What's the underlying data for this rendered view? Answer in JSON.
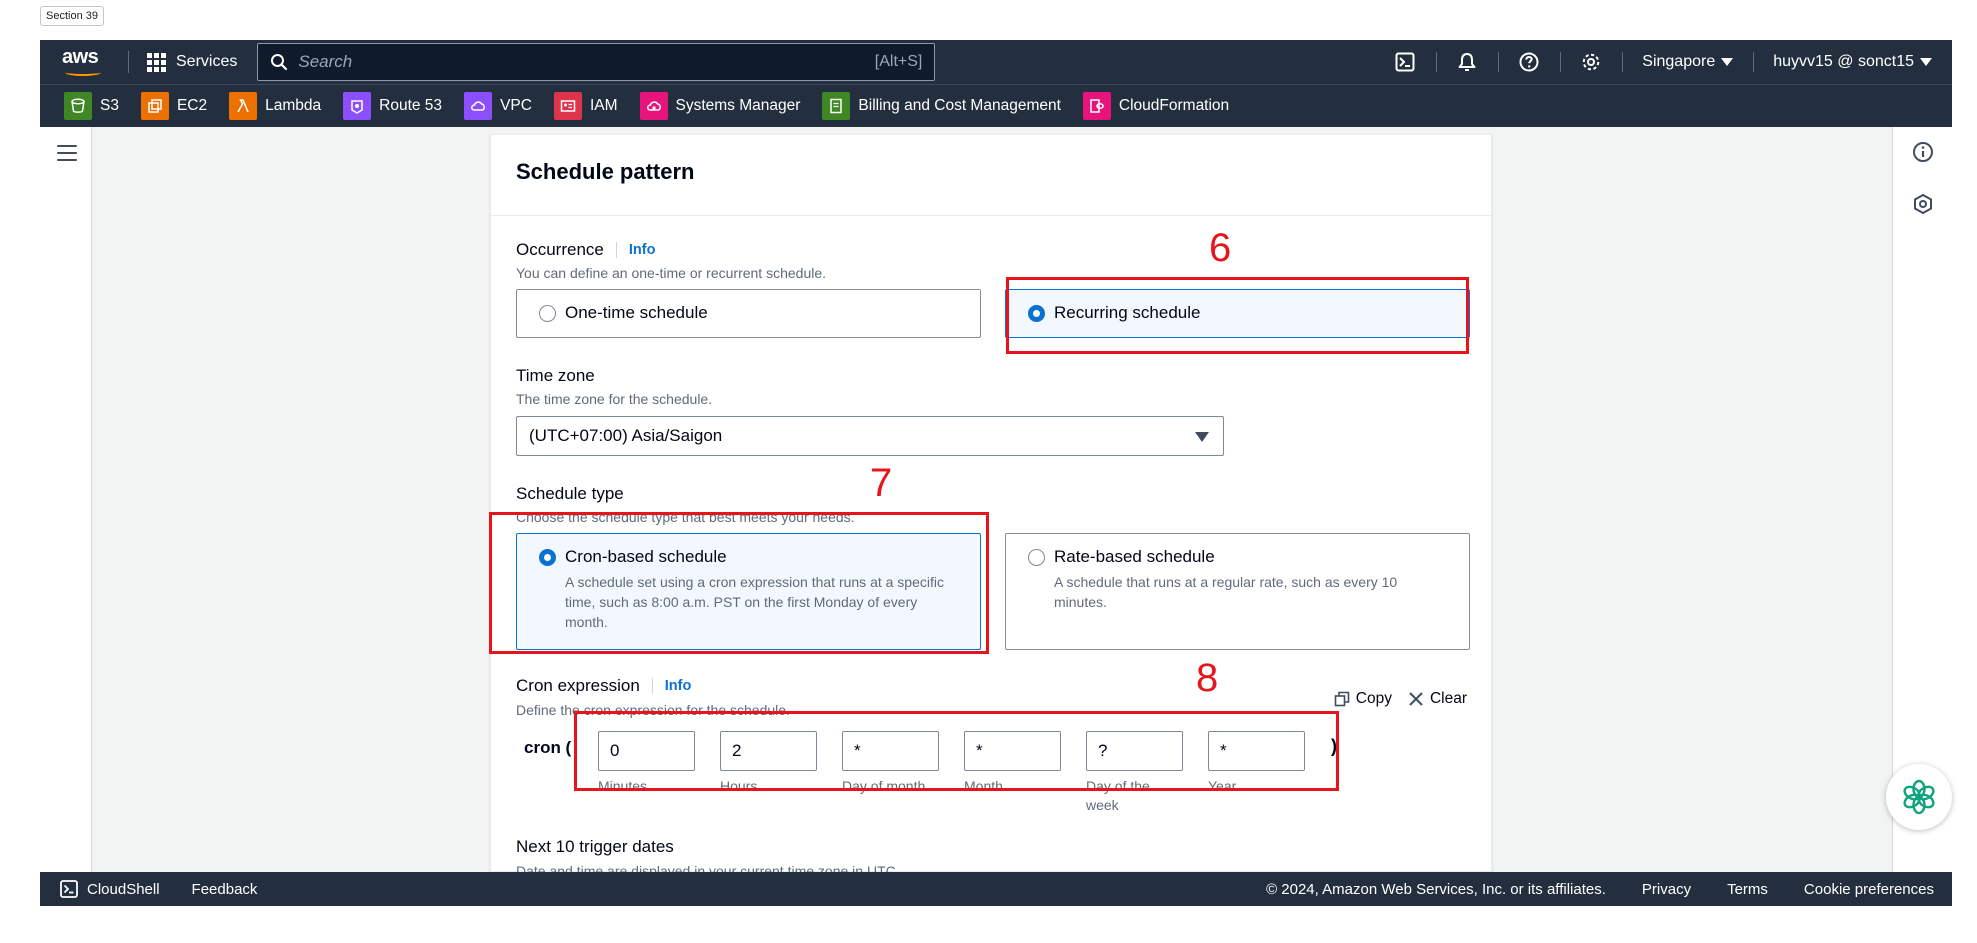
{
  "section_tag": "Section 39",
  "topnav": {
    "logo_text": "aws",
    "services_label": "Services",
    "search_placeholder": "Search",
    "search_hint": "[Alt+S]",
    "region": "Singapore",
    "account": "huyvv15 @ sonct15"
  },
  "favorites": [
    {
      "label": "S3",
      "color": "#3f8624"
    },
    {
      "label": "EC2",
      "color": "#ed7100"
    },
    {
      "label": "Lambda",
      "color": "#ed7100"
    },
    {
      "label": "Route 53",
      "color": "#8c4fff"
    },
    {
      "label": "VPC",
      "color": "#8c4fff"
    },
    {
      "label": "IAM",
      "color": "#dd344c"
    },
    {
      "label": "Systems Manager",
      "color": "#e7157b"
    },
    {
      "label": "Billing and Cost Management",
      "color": "#3f8624"
    },
    {
      "label": "CloudFormation",
      "color": "#e7157b"
    }
  ],
  "panel": {
    "title": "Schedule pattern",
    "occurrence": {
      "label": "Occurrence",
      "info": "Info",
      "description": "You can define an one-time or recurrent schedule.",
      "option_one_time": "One-time schedule",
      "option_recurring": "Recurring schedule",
      "selected": "recurring"
    },
    "timezone": {
      "label": "Time zone",
      "description": "The time zone for the schedule.",
      "value": "(UTC+07:00) Asia/Saigon"
    },
    "schedule_type": {
      "label": "Schedule type",
      "description": "Choose the schedule type that best meets your needs.",
      "cron_title": "Cron-based schedule",
      "cron_desc": "A schedule set using a cron expression that runs at a specific time, such as 8:00 a.m. PST on the first Monday of every month.",
      "rate_title": "Rate-based schedule",
      "rate_desc": "A schedule that runs at a regular rate, such as every 10 minutes.",
      "selected": "cron"
    },
    "cron": {
      "label": "Cron expression",
      "info": "Info",
      "description": "Define the cron expression for the schedule.",
      "copy_label": "Copy",
      "clear_label": "Clear",
      "prefix": "cron (",
      "suffix": ")",
      "fields": [
        {
          "value": "0",
          "label": "Minutes"
        },
        {
          "value": "2",
          "label": "Hours"
        },
        {
          "value": "*",
          "label": "Day of month"
        },
        {
          "value": "*",
          "label": "Month"
        },
        {
          "value": "?",
          "label": "Day of the week"
        },
        {
          "value": "*",
          "label": "Year"
        }
      ]
    },
    "next_trigger": {
      "label": "Next 10 trigger dates",
      "description": "Date and time are displayed in your current time zone in UTC."
    }
  },
  "annotations": [
    "6",
    "7",
    "8"
  ],
  "footer": {
    "cloudshell": "CloudShell",
    "feedback": "Feedback",
    "copyright": "© 2024, Amazon Web Services, Inc. or its affiliates.",
    "privacy": "Privacy",
    "terms": "Terms",
    "cookie": "Cookie preferences"
  },
  "colors": {
    "nav_bg": "#232f3e",
    "accent": "#0972d3",
    "annotation": "#e8141c",
    "aws_orange": "#ff9900"
  }
}
